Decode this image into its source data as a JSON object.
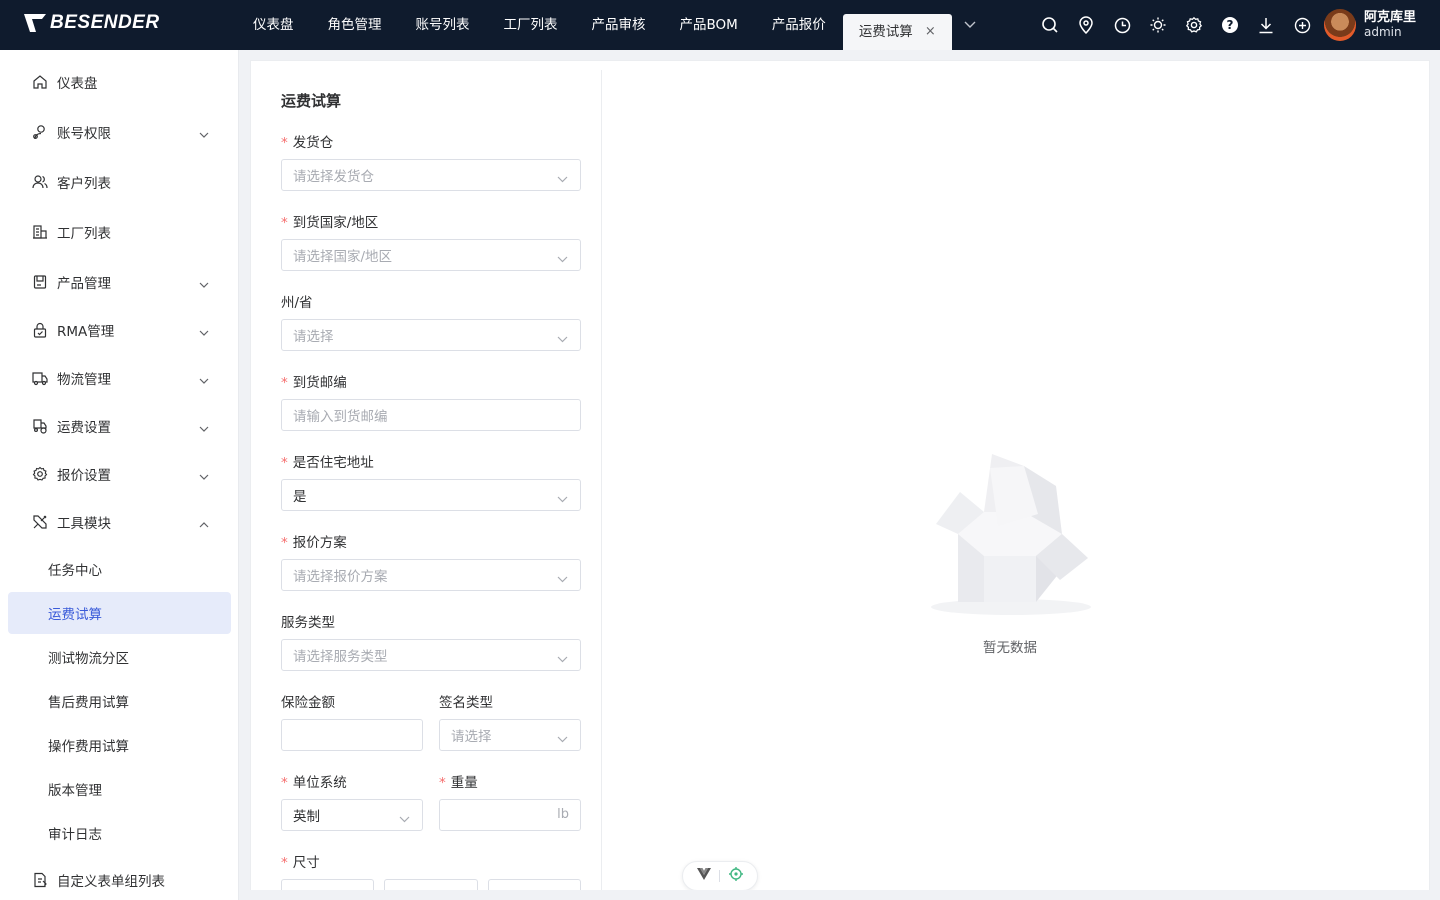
{
  "app": {
    "logo_text": "BESENDER"
  },
  "nav": {
    "tabs": [
      {
        "label": "仪表盘"
      },
      {
        "label": "角色管理"
      },
      {
        "label": "账号列表"
      },
      {
        "label": "工厂列表"
      },
      {
        "label": "产品审核"
      },
      {
        "label": "产品BOM"
      },
      {
        "label": "产品报价"
      }
    ],
    "active_tab": {
      "label": "运费试算",
      "close": "×"
    },
    "tool_icons": [
      "search-icon",
      "location-icon",
      "clock-icon",
      "sun-icon",
      "gear-icon",
      "help-icon",
      "download-icon",
      "plus-circle-icon"
    ]
  },
  "user": {
    "name": "阿克库里",
    "role": "admin"
  },
  "sidebar": {
    "items": [
      {
        "label": "仪表盘",
        "icon": "home-icon",
        "expandable": false
      },
      {
        "label": "账号权限",
        "icon": "user-key-icon",
        "expandable": true
      },
      {
        "label": "客户列表",
        "icon": "users-icon",
        "expandable": false
      },
      {
        "label": "工厂列表",
        "icon": "building-icon",
        "expandable": false
      },
      {
        "label": "产品管理",
        "icon": "box-icon",
        "expandable": true
      },
      {
        "label": "RMA管理",
        "icon": "lock-icon",
        "expandable": true
      },
      {
        "label": "物流管理",
        "icon": "truck-icon",
        "expandable": true
      },
      {
        "label": "运费设置",
        "icon": "fee-icon",
        "expandable": true
      },
      {
        "label": "报价设置",
        "icon": "gear-icon",
        "expandable": true
      },
      {
        "label": "工具模块",
        "icon": "tools-icon",
        "expandable": true,
        "expanded": true
      }
    ],
    "subitems": [
      {
        "label": "任务中心"
      },
      {
        "label": "运费试算",
        "active": true
      },
      {
        "label": "测试物流分区"
      },
      {
        "label": "售后费用试算"
      },
      {
        "label": "操作费用试算"
      },
      {
        "label": "版本管理"
      },
      {
        "label": "审计日志"
      }
    ],
    "last_item": {
      "label": "自定义表单组列表",
      "icon": "form-icon"
    }
  },
  "form": {
    "title": "运费试算",
    "warehouse": {
      "label": "发货仓",
      "required": true,
      "placeholder": "请选择发货仓"
    },
    "country": {
      "label": "到货国家/地区",
      "required": true,
      "placeholder": "请选择国家/地区"
    },
    "state": {
      "label": "州/省",
      "required": false,
      "placeholder": "请选择"
    },
    "zip": {
      "label": "到货邮编",
      "required": true,
      "placeholder": "请输入到货邮编"
    },
    "residential": {
      "label": "是否住宅地址",
      "required": true,
      "value": "是"
    },
    "plan": {
      "label": "报价方案",
      "required": true,
      "placeholder": "请选择报价方案"
    },
    "service": {
      "label": "服务类型",
      "required": false,
      "placeholder": "请选择服务类型"
    },
    "insurance": {
      "label": "保险金额",
      "required": false,
      "value": ""
    },
    "signature": {
      "label": "签名类型",
      "required": false,
      "placeholder": "请选择"
    },
    "unit_system": {
      "label": "单位系统",
      "required": true,
      "value": "英制"
    },
    "weight": {
      "label": "重量",
      "required": true,
      "unit": "lb"
    },
    "size": {
      "label": "尺寸",
      "required": true
    }
  },
  "result": {
    "empty_text": "暂无数据"
  }
}
